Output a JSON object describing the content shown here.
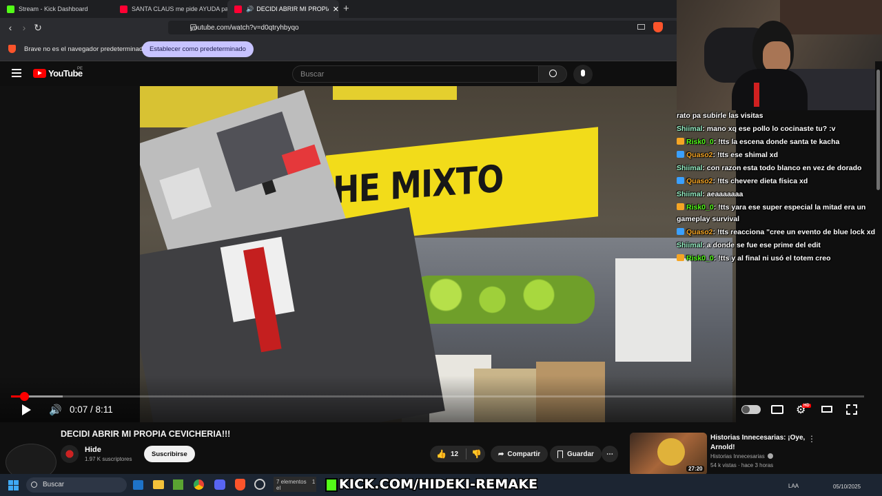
{
  "tabs": [
    {
      "label": "Stream - Kick Dashboard",
      "color": "#53fc18"
    },
    {
      "label": "SANTA CLAUS me pide AYUDA para",
      "color": "#ff0033"
    },
    {
      "label": "DECIDI ABRIR MI PROPIA CEV",
      "color": "#ff0033"
    }
  ],
  "address_bar": {
    "url": "youtube.com/watch?v=d0qtryhbyqo"
  },
  "infobar": {
    "message": "Brave no es el navegador predeterminado",
    "button": "Establecer como predeterminado"
  },
  "youtube": {
    "logo": "YouTube",
    "region": "PE",
    "search_placeholder": "Buscar"
  },
  "video": {
    "sign_text": "HE MIXTO",
    "time": "0:07 / 8:11",
    "progress_fraction": 0.015,
    "title": "DECIDI ABRIR MI PROPIA CEVICHERIA!!!"
  },
  "channel": {
    "name": "Hide",
    "subscribers": "1.97 K suscriptores",
    "subscribe_label": "Suscribirse"
  },
  "actions": {
    "likes": "12",
    "share": "Compartir",
    "save": "Guardar"
  },
  "related": {
    "title_line1": "Historias Innecesarias: ¡Oye,",
    "title_line2": "Arnold!",
    "channel": "Historias Innecesarias",
    "meta": "54 k vistas · hace 3 horas",
    "duration": "27:20"
  },
  "chat": [
    {
      "user": "",
      "text": "rato pa subirle las visitas",
      "color": "#ffffff",
      "badge": ""
    },
    {
      "user": "Shiimal",
      "text": ": mano xq ese pollo lo cocinaste tu? :v",
      "color": "#9bf5c9",
      "badge": ""
    },
    {
      "user": "Risk0_0",
      "text": ": !tts la escena donde santa te kacha",
      "color": "#53fc18",
      "badge": "#f5a524"
    },
    {
      "user": "Quaso2",
      "text": ": !tts ese shimal xd",
      "color": "#f5a524",
      "badge": "#3aa0ff"
    },
    {
      "user": "Shiimal",
      "text": ": con razon esta todo blanco en vez de dorado",
      "color": "#9bf5c9",
      "badge": ""
    },
    {
      "user": "Quaso2",
      "text": ": !tts chevere dieta física xd",
      "color": "#f5a524",
      "badge": "#3aa0ff"
    },
    {
      "user": "Shiimal",
      "text": ": aeaaaaaaa",
      "color": "#9bf5c9",
      "badge": ""
    },
    {
      "user": "Risk0_0",
      "text": ": !tts yara ese super especial la mitad era un gameplay survival",
      "color": "#53fc18",
      "badge": "#f5a524"
    },
    {
      "user": "Quaso2",
      "text": ": !tts reacciona \"cree un evento de blue lock xd",
      "color": "#f5a524",
      "badge": "#3aa0ff"
    },
    {
      "user": "Shiimal",
      "text": ": a donde se fue ese prime del edit",
      "color": "#9bf5c9",
      "badge": ""
    },
    {
      "user": "Risk0_0",
      "text": ": !tts y al final ni usó el totem creo",
      "color": "#53fc18",
      "badge": "#f5a524"
    }
  ],
  "taskbar": {
    "search": "Buscar",
    "explorer_info": "7 elementos",
    "explorer_info2": "1 el",
    "banner": "KICK.COM/HIDEKI-REMAKE",
    "lang": "LAA",
    "date": "05/10/2025"
  }
}
